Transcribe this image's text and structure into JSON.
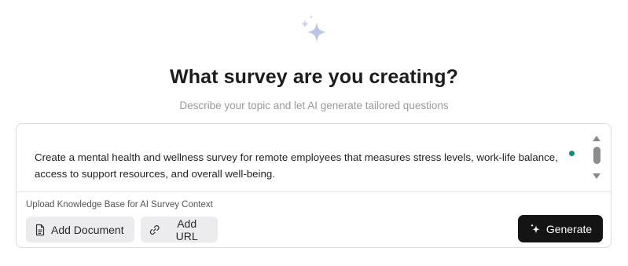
{
  "header": {
    "title": "What survey are you creating?",
    "subtitle": "Describe your topic and let AI generate tailored questions"
  },
  "prompt": {
    "text": "Create a mental health and wellness survey for remote employees that measures stress levels, work-life balance, access to support resources, and overall well-being."
  },
  "knowledge_base": {
    "label": "Upload Knowledge Base for AI Survey Context",
    "add_document_label": "Add Document",
    "add_url_label": "Add URL"
  },
  "actions": {
    "generate_label": "Generate"
  },
  "icons": {
    "hero": "sparkle-icon",
    "document": "document-icon",
    "url": "link-icon",
    "generate": "sparkle-icon"
  },
  "colors": {
    "sparkle": "#b9c4e6",
    "generate_bg": "#141414",
    "secondary_bg": "#ececef",
    "cursor_dot": "#1a8a72"
  }
}
